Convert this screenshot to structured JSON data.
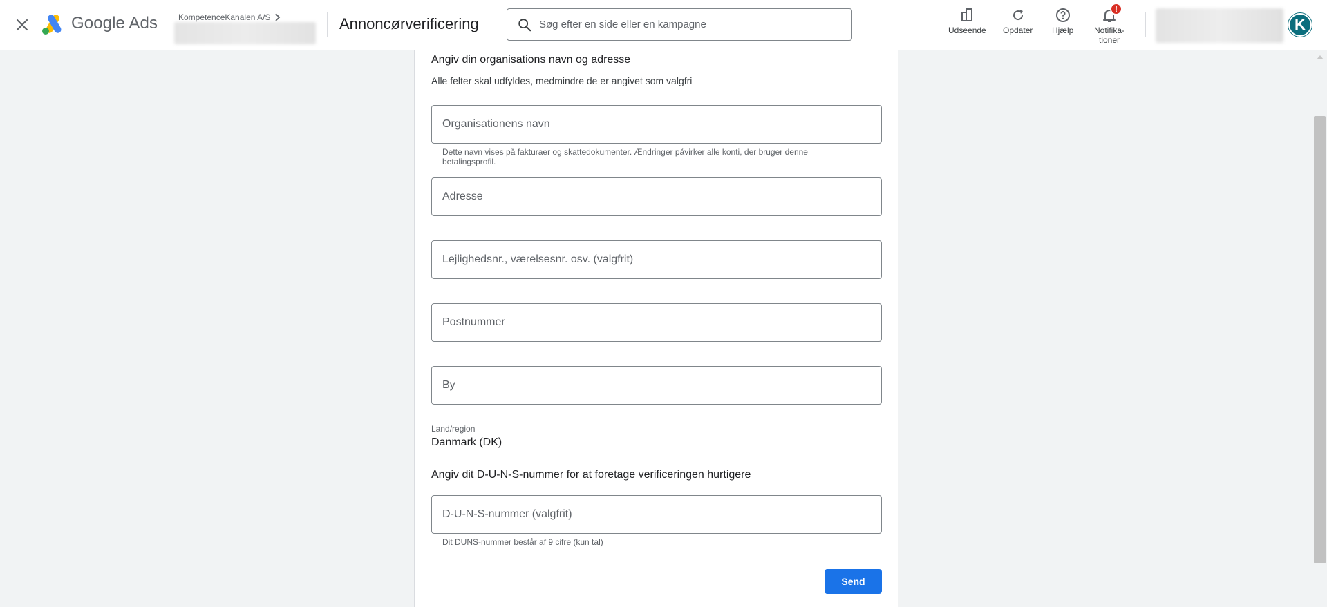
{
  "header": {
    "logo_text": "Google Ads",
    "account_name": "KompetenceKanalen A/S",
    "page_title": "Annoncørverificering",
    "search_placeholder": "Søg efter en side eller en kampagne",
    "actions": {
      "appearance": "Udseende",
      "refresh": "Opdater",
      "help": "Hjælp",
      "notifications_line1": "Notifika-",
      "notifications_line2": "tioner",
      "notifications_badge": "!"
    },
    "avatar_letter": "K"
  },
  "form": {
    "section1_title": "Angiv din organisations navn og adresse",
    "section1_subtitle": "Alle felter skal udfyldes, medmindre de er angivet som valgfri",
    "org_name_placeholder": "Organisationens navn",
    "org_name_hint": "Dette navn vises på fakturaer og skattedokumenter. Ændringer påvirker alle konti, der bruger denne betalingsprofil.",
    "address_placeholder": "Adresse",
    "apartment_placeholder": "Lejlighedsnr., værelsesnr. osv. (valgfrit)",
    "postal_placeholder": "Postnummer",
    "city_placeholder": "By",
    "country_label": "Land/region",
    "country_value": "Danmark (DK)",
    "section2_title": "Angiv dit D-U-N-S-nummer for at foretage verificeringen hurtigere",
    "duns_placeholder": "D-U-N-S-nummer (valgfrit)",
    "duns_hint": "Dit DUNS-nummer består af 9 cifre (kun tal)",
    "submit_label": "Send"
  },
  "colors": {
    "primary": "#1a73e8",
    "badge": "#d93025",
    "avatar": "#0b6e7d"
  }
}
